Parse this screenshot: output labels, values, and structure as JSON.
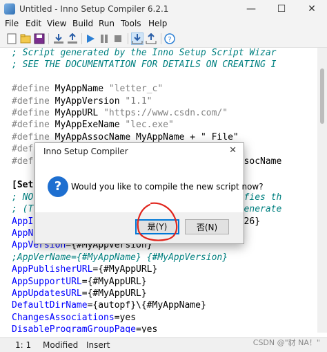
{
  "window": {
    "title": "Untitled - Inno Setup Compiler 6.2.1",
    "minimize": "—",
    "maximize": "☐",
    "close": "✕"
  },
  "menu": [
    "File",
    "Edit",
    "View",
    "Build",
    "Run",
    "Tools",
    "Help"
  ],
  "toolbar": {
    "icons": [
      "new-file-icon",
      "open-icon",
      "save-icon",
      "compile-icon",
      "run-icon",
      "pause-icon",
      "stop-icon",
      "download-icon",
      "upload-icon",
      "help-icon"
    ]
  },
  "editor": {
    "lines": [
      [
        {
          "t": "; Script generated by the Inno Setup Script Wizar",
          "c": "cm"
        }
      ],
      [
        {
          "t": "; SEE THE DOCUMENTATION FOR DETAILS ON CREATING I",
          "c": "cm"
        }
      ],
      [
        {
          "t": "",
          "c": "plain"
        }
      ],
      [
        {
          "t": "#define ",
          "c": "dir"
        },
        {
          "t": "MyAppName ",
          "c": "plain"
        },
        {
          "t": "\"letter_c\"",
          "c": "str"
        }
      ],
      [
        {
          "t": "#define ",
          "c": "dir"
        },
        {
          "t": "MyAppVersion ",
          "c": "plain"
        },
        {
          "t": "\"1.1\"",
          "c": "str"
        }
      ],
      [
        {
          "t": "#define ",
          "c": "dir"
        },
        {
          "t": "MyAppURL ",
          "c": "plain"
        },
        {
          "t": "\"https://www.csdn.com/\"",
          "c": "str"
        }
      ],
      [
        {
          "t": "#define ",
          "c": "dir"
        },
        {
          "t": "MyAppExeName ",
          "c": "plain"
        },
        {
          "t": "\"lec.exe\"",
          "c": "str"
        }
      ],
      [
        {
          "t": "#define ",
          "c": "dir"
        },
        {
          "t": "MyAppAssocName MyAppName + \" File\"",
          "c": "plain"
        }
      ],
      [
        {
          "t": "#def",
          "c": "dir"
        }
      ],
      [
        {
          "t": "#def",
          "c": "dir"
        },
        {
          "t": "                                  AppAssocName",
          "c": "plain"
        }
      ],
      [
        {
          "t": "",
          "c": "plain"
        }
      ],
      [
        {
          "t": "[Set",
          "c": "sec"
        }
      ],
      [
        {
          "t": "; NO",
          "c": "cm"
        },
        {
          "t": "                                  dentifies th",
          "c": "cm"
        }
      ],
      [
        {
          "t": "; (T",
          "c": "cm"
        },
        {
          "t": "                                  s | Generate",
          "c": "cm"
        }
      ],
      [
        {
          "t": "AppI",
          "c": "key"
        },
        {
          "t": "                                  E7CFE26}",
          "c": "plain"
        }
      ],
      [
        {
          "t": "AppN",
          "c": "key"
        }
      ],
      [
        {
          "t": "AppVersion",
          "c": "key"
        },
        {
          "t": "={#MyAppVersion}",
          "c": "plain"
        }
      ],
      [
        {
          "t": ";AppVerName={#MyAppName} {#MyAppVersion}",
          "c": "cm"
        }
      ],
      [
        {
          "t": "AppPublisherURL",
          "c": "key"
        },
        {
          "t": "={#MyAppURL}",
          "c": "plain"
        }
      ],
      [
        {
          "t": "AppSupportURL",
          "c": "key"
        },
        {
          "t": "={#MyAppURL}",
          "c": "plain"
        }
      ],
      [
        {
          "t": "AppUpdatesURL",
          "c": "key"
        },
        {
          "t": "={#MyAppURL}",
          "c": "plain"
        }
      ],
      [
        {
          "t": "DefaultDirName",
          "c": "key"
        },
        {
          "t": "={autopf}\\{#MyAppName}",
          "c": "plain"
        }
      ],
      [
        {
          "t": "ChangesAssociations",
          "c": "key"
        },
        {
          "t": "=yes",
          "c": "plain"
        }
      ],
      [
        {
          "t": "DisableProgramGroupPage",
          "c": "key"
        },
        {
          "t": "=yes",
          "c": "plain"
        }
      ]
    ]
  },
  "dialog": {
    "title": "Inno Setup Compiler",
    "message": "Would you like to compile the new script now?",
    "yes": "是(Y)",
    "no": "否(N)",
    "close": "✕"
  },
  "status": {
    "position": "1:   1",
    "modified": "Modified",
    "mode": "Insert"
  },
  "watermark": "CSDN @\"豺 NA！\""
}
